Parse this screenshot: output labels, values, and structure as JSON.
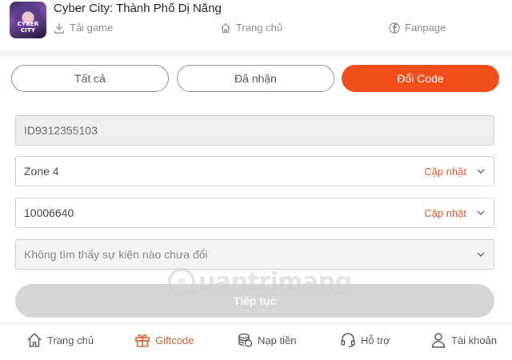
{
  "header": {
    "game_title": "Cyber City: Thành Phố Dị Năng",
    "icon_text": "CYBER CITY",
    "links": [
      {
        "label": "Tải game",
        "icon": "download-icon"
      },
      {
        "label": "Trang chủ",
        "icon": "home-icon"
      },
      {
        "label": "Fanpage",
        "icon": "facebook-icon"
      }
    ]
  },
  "tabs": [
    {
      "label": "Tất cả",
      "active": false
    },
    {
      "label": "Đã nhận",
      "active": false
    },
    {
      "label": "Đổi Code",
      "active": true
    }
  ],
  "form": {
    "player_id": "ID9312355103",
    "server": {
      "value": "Zone 4",
      "action": "Cập nhật"
    },
    "character": {
      "value": "10006640",
      "action": "Cập nhật"
    },
    "event": {
      "placeholder": "Không tìm thấy sự kiện nào chưa đổi"
    },
    "continue_label": "Tiếp tục"
  },
  "watermark": {
    "text": "uantrimang"
  },
  "bottom_nav": [
    {
      "label": "Trang chủ",
      "icon": "home-icon",
      "active": false
    },
    {
      "label": "Giftcode",
      "icon": "gift-icon",
      "active": true
    },
    {
      "label": "Nạp tiền",
      "icon": "coins-icon",
      "active": false
    },
    {
      "label": "Hỗ trợ",
      "icon": "headset-icon",
      "active": false
    },
    {
      "label": "Tài khoản",
      "icon": "user-icon",
      "active": false
    }
  ],
  "colors": {
    "accent": "#f04d1a",
    "update_text": "#e4572e",
    "disabled_button": "#d5d5d5"
  }
}
